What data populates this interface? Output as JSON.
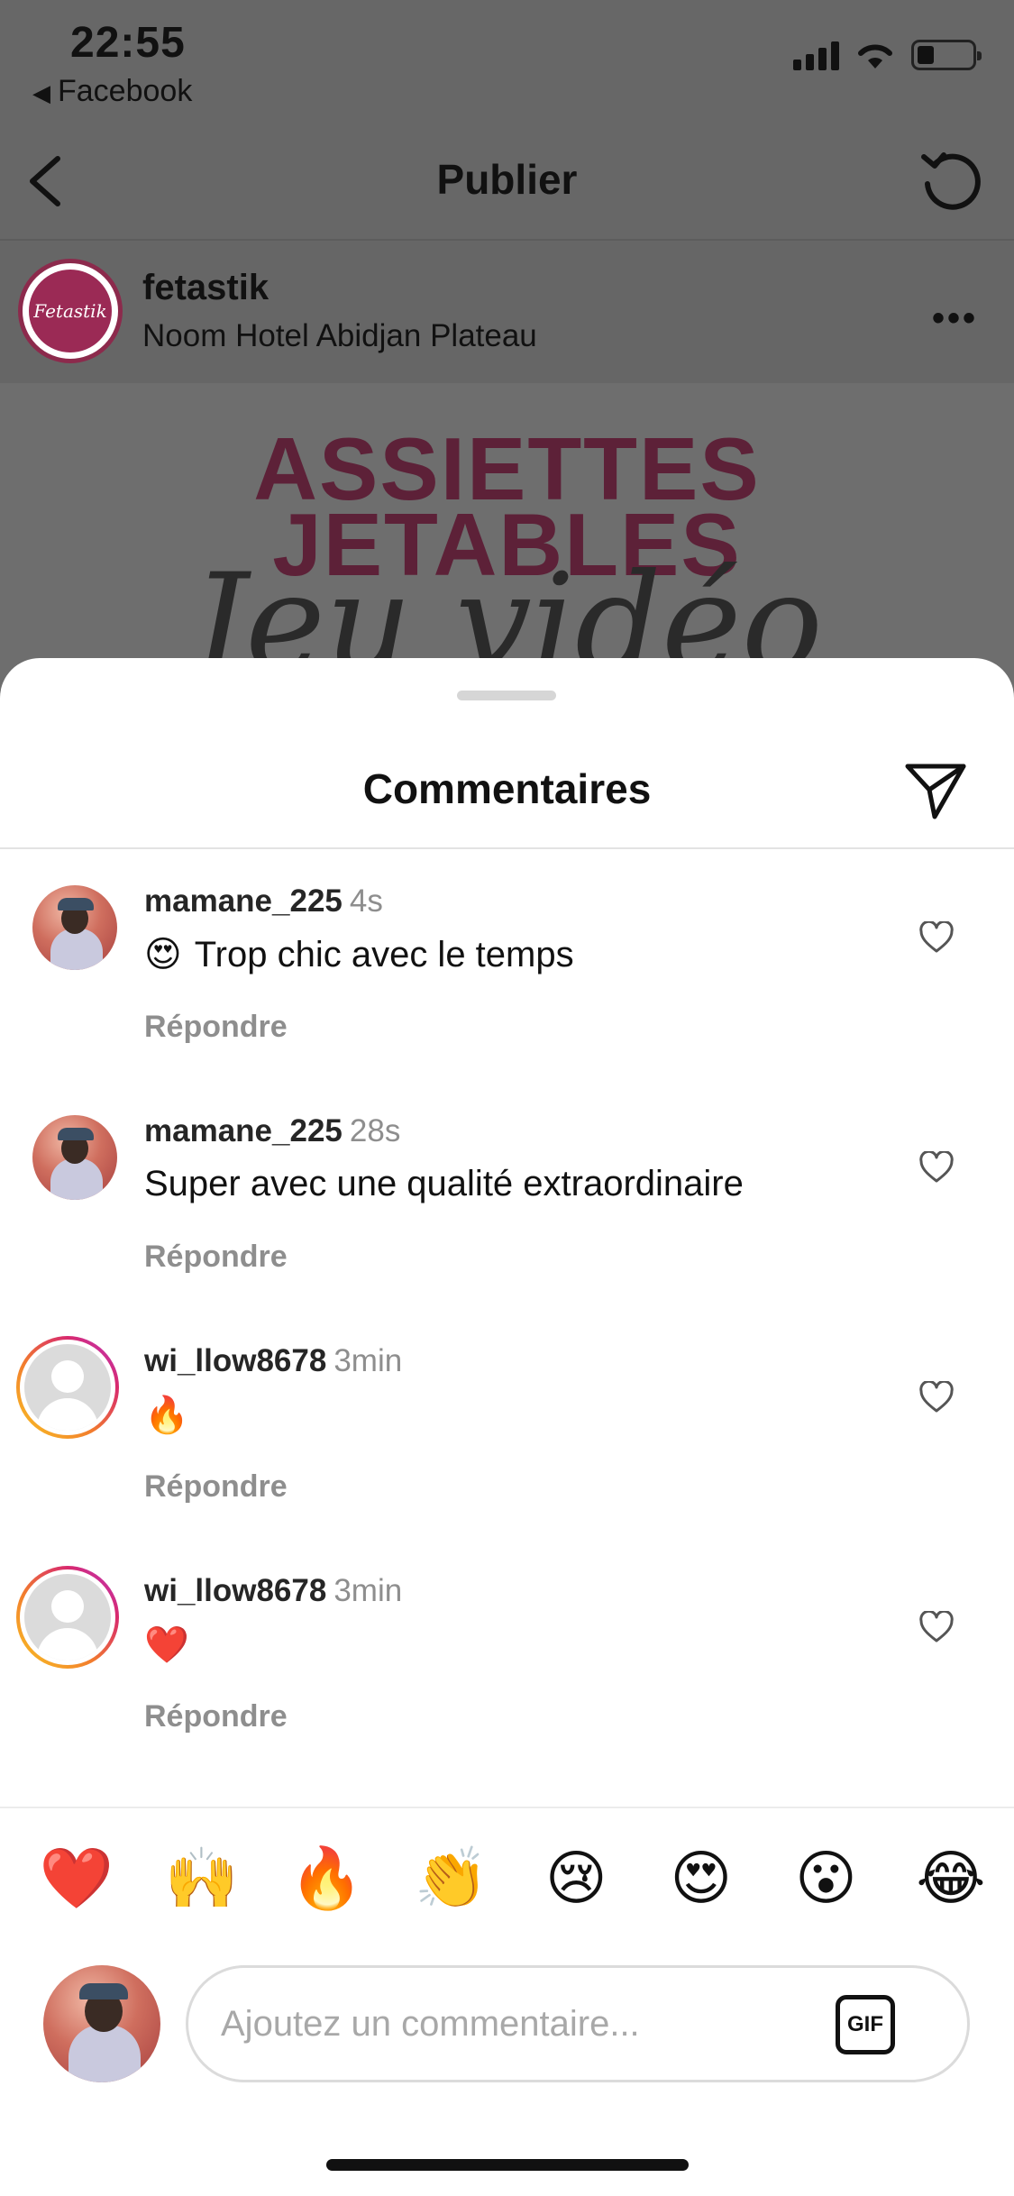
{
  "status_bar": {
    "time": "22:55",
    "back_app": "Facebook",
    "back_glyph": "◀"
  },
  "nav": {
    "title": "Publier"
  },
  "post": {
    "username": "fetastik",
    "location": "Noom Hotel Abidjan Plateau",
    "avatar_text": "Fetastik",
    "more": "•••",
    "image_line1": "ASSIETTES",
    "image_line2": "JETABLES",
    "image_script": "Jeu vidéo"
  },
  "sheet": {
    "title": "Commentaires"
  },
  "comments": [
    {
      "user": "mamane_225",
      "time": "4s",
      "emoji": "😍",
      "text": "Trop chic avec le temps",
      "reply": "Répondre"
    },
    {
      "user": "mamane_225",
      "time": "28s",
      "emoji": "",
      "text": "Super avec une qualité extraordinaire",
      "reply": "Répondre"
    },
    {
      "user": "wi_llow8678",
      "time": "3min",
      "emoji": "🔥",
      "text": "",
      "reply": "Répondre"
    },
    {
      "user": "wi_llow8678",
      "time": "3min",
      "emoji": "❤️",
      "text": "",
      "reply": "Répondre"
    }
  ],
  "quick_reactions": [
    "❤️",
    "🙌",
    "🔥",
    "👏",
    "😢",
    "😍",
    "😮",
    "😂"
  ],
  "composer": {
    "placeholder": "Ajoutez un commentaire...",
    "value": "",
    "gif_label": "GIF"
  },
  "colors": {
    "brand_magenta": "#9b2a55",
    "secondary_text": "#8e8e8e",
    "story_ring": "#d8296e"
  }
}
